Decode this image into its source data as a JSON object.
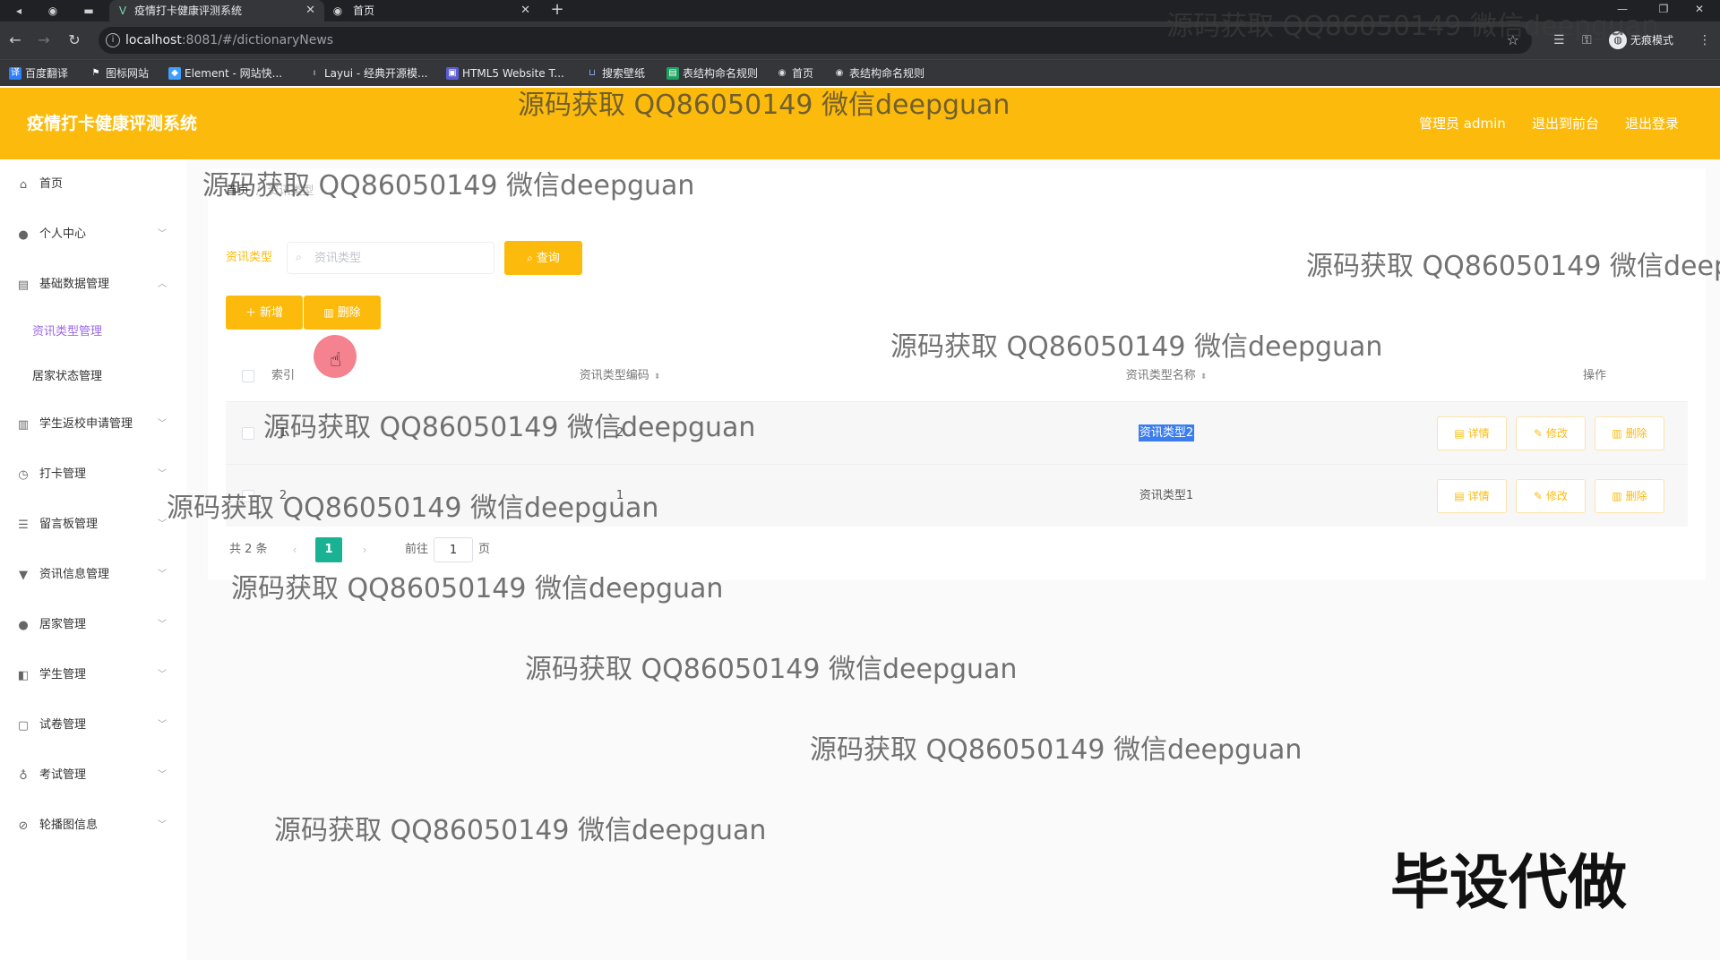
{
  "browser": {
    "tabs": [
      {
        "title": "疫情打卡健康评测系统",
        "close": "✕"
      },
      {
        "title": "首页",
        "close": "✕"
      }
    ],
    "new_tab": "+",
    "url_host": "localhost",
    "url_path": ":8081/#/dictionaryNews",
    "incognito_label": "无痕模式",
    "bookmarks": [
      "百度翻译",
      "图标网站",
      "Element - 网站快...",
      "Layui - 经典开源模...",
      "HTML5 Website T...",
      "搜索壁纸",
      "表结构命名规则",
      "首页",
      "表结构命名规则"
    ]
  },
  "header": {
    "title": "疫情打卡健康评测系统",
    "admin": "管理员 admin",
    "front": "退出到前台",
    "logout": "退出登录"
  },
  "sidebar": {
    "items": [
      {
        "label": "首页",
        "icon": "home-icon"
      },
      {
        "label": "个人中心",
        "icon": "user-icon"
      },
      {
        "label": "基础数据管理",
        "icon": "data-icon"
      },
      {
        "label": "学生返校申请管理",
        "icon": "chart-icon"
      },
      {
        "label": "打卡管理",
        "icon": "clock-icon"
      },
      {
        "label": "留言板管理",
        "icon": "list-icon"
      },
      {
        "label": "资讯信息管理",
        "icon": "pin-icon"
      },
      {
        "label": "居家管理",
        "icon": "person-icon"
      },
      {
        "label": "学生管理",
        "icon": "student-icon"
      },
      {
        "label": "试卷管理",
        "icon": "paper-icon"
      },
      {
        "label": "考试管理",
        "icon": "mic-icon"
      },
      {
        "label": "轮播图信息",
        "icon": "image-icon"
      }
    ],
    "sub_items": [
      "资讯类型管理",
      "居家状态管理"
    ]
  },
  "breadcrumb": {
    "home": "首页",
    "current": "资讯类型"
  },
  "filter": {
    "label": "资讯类型",
    "placeholder": "资讯类型",
    "query_button": "查询"
  },
  "actions": {
    "add": "新增",
    "delete": "删除"
  },
  "table": {
    "headers": [
      "索引",
      "资讯类型编码",
      "资讯类型名称",
      "操作"
    ],
    "rows": [
      {
        "index": "1",
        "code": "2",
        "name": "资讯类型2"
      },
      {
        "index": "2",
        "code": "1",
        "name": "资讯类型1"
      }
    ],
    "row_actions": {
      "detail": "详情",
      "edit": "修改",
      "delete": "删除"
    }
  },
  "pagination": {
    "total": "共 2 条",
    "current": "1",
    "goto_label": "前往",
    "goto_value": "1",
    "page_suffix": "页",
    "prev": "‹",
    "next": "›"
  },
  "watermark": {
    "text": "源码获取 QQ86050149 微信deepguan",
    "big": "毕设代做"
  }
}
